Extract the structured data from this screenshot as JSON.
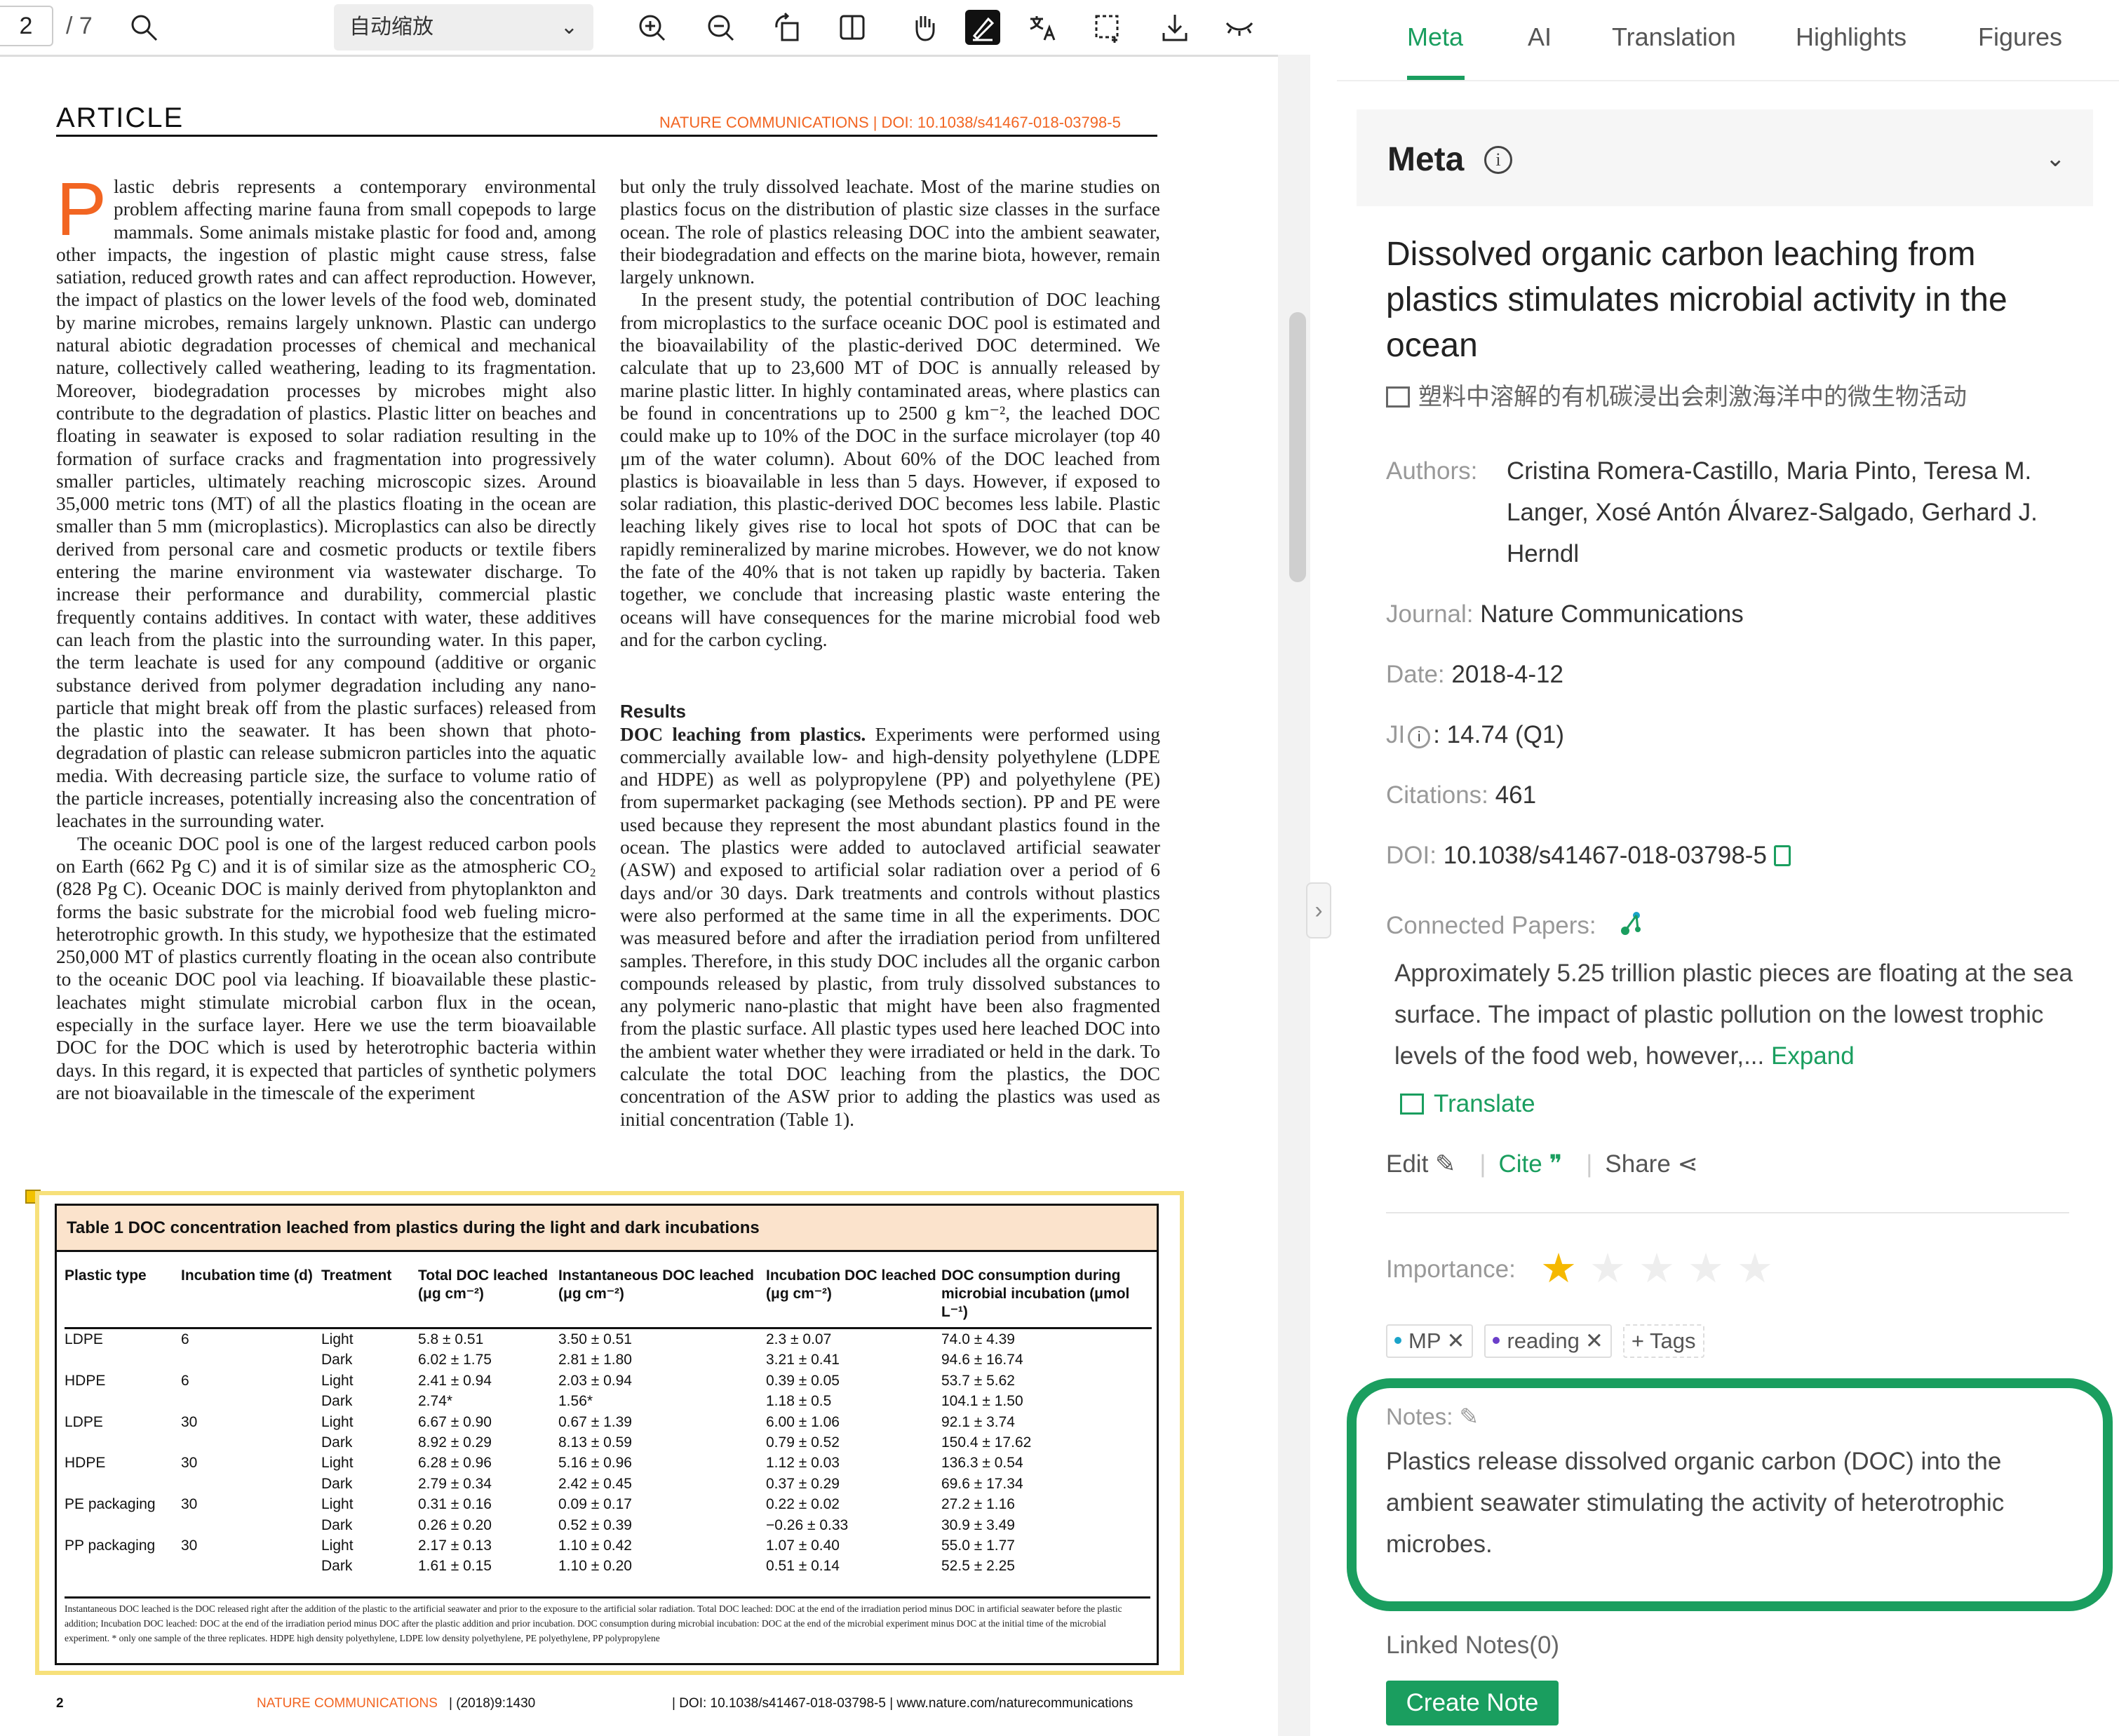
{
  "toolbar": {
    "page_current": "2",
    "page_total": "/ 7",
    "zoom_value": "自动缩放",
    "zoom_chevron": "⌄"
  },
  "document": {
    "section_label": "ARTICLE",
    "header_doi": "NATURE COMMUNICATIONS | DOI: 10.1038/s41467-018-03798-5",
    "left_col": {
      "drop_cap": "P",
      "p1": "lastic debris represents a contemporary environmental problem affecting marine fauna from small copepods to large mammals. Some animals mistake plastic for food and, among other impacts, the ingestion of plastic might cause stress, false satiation, reduced growth rates and can affect reproduction. However, the impact of plastics on the lower levels of the food web, dominated by marine microbes, remains largely unknown. Plastic can undergo natural abiotic degradation processes of chemical and mechanical nature, collectively called weathering, leading to its fragmentation. Moreover, biodegradation processes by microbes might also contribute to the degradation of plastics. Plastic litter on beaches and floating in seawater is exposed to solar radiation resulting in the formation of surface cracks and fragmentation into progressively smaller particles, ultimately reaching microscopic sizes. Around 35,000 metric tons (MT) of all the plastics floating in the ocean are smaller than 5 mm (microplastics). Microplastics can also be directly derived from personal care and cosmetic products or textile fibers entering the marine environment via wastewater discharge. To increase their performance and durability, commercial plastic frequently contains additives. In contact with water, these additives can leach from the plastic into the surrounding water. In this paper, the term leachate is used for any compound (additive or organic substance derived from polymer degradation including any nano-particle that might break off from the plastic surfaces) released from the plastic into the seawater. It has been shown that photo-degradation of plastic can release submicron particles into the aquatic media. With decreasing particle size, the surface to volume ratio of the particle increases, potentially increasing also the concentration of leachates in the surrounding water.",
      "p2": "The oceanic DOC pool is one of the largest reduced carbon pools on Earth (662 Pg C) and it is of similar size as the atmospheric CO₂ (828 Pg C). Oceanic DOC is mainly derived from phytoplankton and forms the basic substrate for the microbial food web fueling micro-heterotrophic growth. In this study, we hypothesize that the estimated 250,000 MT of plastics currently floating in the ocean also contribute to the oceanic DOC pool via leaching. If bioavailable these plastic-leachates might stimulate microbial carbon flux in the ocean, especially in the surface layer. Here we use the term bioavailable DOC for the DOC which is used by heterotrophic bacteria within days. In this regard, it is expected that particles of synthetic polymers are not bioavailable in the timescale of the experiment"
    },
    "right_col": {
      "p1": "but only the truly dissolved leachate. Most of the marine studies on plastics focus on the distribution of plastic size classes in the surface ocean. The role of plastics releasing DOC into the ambient seawater, their biodegradation and effects on the marine biota, however, remain largely unknown.",
      "p2": "In the present study, the potential contribution of DOC leaching from microplastics to the surface oceanic DOC pool is estimated and the bioavailability of the plastic-derived DOC determined. We calculate that up to 23,600 MT of DOC is annually released by marine plastic litter. In highly contaminated areas, where plastics can be found in concentrations up to 2500 g km⁻², the leached DOC could make up to 10% of the DOC in the surface microlayer (top 40 μm of the water column). About 60% of the DOC leached from plastics is bioavailable in less than 5 days. However, if exposed to solar radiation, this plastic-derived DOC becomes less labile. Plastic leaching likely gives rise to local hot spots of DOC that can be rapidly remineralized by marine microbes. However, we do not know the fate of the 40% that is not taken up rapidly by bacteria. Taken together, we conclude that increasing plastic waste entering the oceans will have consequences for the marine microbial food web and for the carbon cycling.",
      "results_head": "Results",
      "sub_head": "DOC leaching from plastics.",
      "p3": "Experiments were performed using commercially available low- and high-density polyethylene (LDPE and HDPE) as well as polypropylene (PP) and polyethylene (PE) from supermarket packaging (see Methods section). PP and PE were used because they represent the most abundant plastics found in the ocean. The plastics were added to autoclaved artificial seawater (ASW) and exposed to artificial solar radiation over a period of 6 days and/or 30 days. Dark treatments and controls without plastics were also performed at the same time in all the experiments. DOC was measured before and after the irradiation period from unfiltered samples. Therefore, in this study DOC includes all the organic carbon compounds released by plastic, from truly dissolved substances to any polymeric nano-plastic that might have been also fragmented from the plastic surface. All plastic types used here leached DOC into the ambient water whether they were irradiated or held in the dark. To calculate the total DOC leaching from the plastics, the DOC concentration of the ASW prior to adding the plastics was used as initial concentration (Table 1)."
    },
    "table": {
      "title": "Table 1 DOC concentration leached from plastics during the light and dark incubations",
      "headers": [
        "Plastic type",
        "Incubation time (d)",
        "Treatment",
        "Total DOC leached (μg cm⁻²)",
        "Instantaneous DOC leached (μg cm⁻²)",
        "Incubation DOC leached (μg cm⁻²)",
        "DOC consumption during microbial incubation (μmol L⁻¹)"
      ],
      "rows": [
        [
          "LDPE",
          "6",
          "Light",
          "5.8 ± 0.51",
          "3.50 ± 0.51",
          "2.3 ± 0.07",
          "74.0 ± 4.39"
        ],
        [
          "",
          "",
          "Dark",
          "6.02 ± 1.75",
          "2.81 ± 1.80",
          "3.21 ± 0.41",
          "94.6 ± 16.74"
        ],
        [
          "HDPE",
          "6",
          "Light",
          "2.41 ± 0.94",
          "2.03 ± 0.94",
          "0.39 ± 0.05",
          "53.7 ± 5.62"
        ],
        [
          "",
          "",
          "Dark",
          "2.74*",
          "1.56*",
          "1.18 ± 0.5",
          "104.1 ± 1.50"
        ],
        [
          "LDPE",
          "30",
          "Light",
          "6.67 ± 0.90",
          "0.67 ± 1.39",
          "6.00 ± 1.06",
          "92.1 ± 3.74"
        ],
        [
          "",
          "",
          "Dark",
          "8.92 ± 0.29",
          "8.13 ± 0.59",
          "0.79 ± 0.52",
          "150.4 ± 17.62"
        ],
        [
          "HDPE",
          "30",
          "Light",
          "6.28 ± 0.96",
          "5.16 ± 0.96",
          "1.12 ± 0.03",
          "136.3 ± 0.54"
        ],
        [
          "",
          "",
          "Dark",
          "2.79 ± 0.34",
          "2.42 ± 0.45",
          "0.37 ± 0.29",
          "69.6 ± 17.34"
        ],
        [
          "PE packaging",
          "30",
          "Light",
          "0.31 ± 0.16",
          "0.09 ± 0.17",
          "0.22 ± 0.02",
          "27.2 ± 1.16"
        ],
        [
          "",
          "",
          "Dark",
          "0.26 ± 0.20",
          "0.52 ± 0.39",
          "−0.26 ± 0.33",
          "30.9 ± 3.49"
        ],
        [
          "PP packaging",
          "30",
          "Light",
          "2.17 ± 0.13",
          "1.10 ± 0.42",
          "1.07 ± 0.40",
          "55.0 ± 1.77"
        ],
        [
          "",
          "",
          "Dark",
          "1.61 ± 0.15",
          "1.10 ± 0.20",
          "0.51 ± 0.14",
          "52.5 ± 2.25"
        ]
      ],
      "footnote": "Instantaneous DOC leached is the DOC released right after the addition of the plastic to the artificial seawater and prior to the exposure to the artificial solar radiation. Total DOC leached: DOC at the end of the irradiation period minus DOC in artificial seawater before the plastic addition; Incubation DOC leached: DOC at the end of the irradiation period minus DOC after the plastic addition and prior incubation. DOC consumption during microbial incubation: DOC at the end of the microbial experiment minus DOC at the initial time of the microbial experiment. * only one sample of the three replicates. HDPE high density polyethylene, LDPE low density polyethylene, PE polyethylene, PP polypropylene"
    },
    "footer": {
      "page_num": "2",
      "journal": "NATURE COMMUNICATIONS",
      "year": "| (2018)9:1430",
      "doi": "| DOI: 10.1038/s41467-018-03798-5 | www.nature.com/naturecommunications"
    }
  },
  "panel": {
    "tabs": [
      "Meta",
      "AI",
      "Translation",
      "Highlights",
      "Figures"
    ],
    "meta_heading": "Meta",
    "paper_title": "Dissolved organic carbon leaching from plastics stimulates microbial activity in the ocean",
    "paper_title_cn": "塑料中溶解的有机碳浸出会刺激海洋中的微生物活动",
    "authors_label": "Authors:",
    "authors_value": "Cristina Romera-Castillo, Maria Pinto, Teresa M. Langer, Xosé Antón Álvarez-Salgado, Gerhard J. Herndl",
    "journal_label": "Journal:",
    "journal_value": "Nature Communications",
    "date_label": "Date:",
    "date_value": "2018-4-12",
    "ji_label": "JI",
    "ji_value": ": 14.74  (Q1)",
    "citations_label": "Citations:",
    "citations_value": "461",
    "doi_label": "DOI:",
    "doi_value": "10.1038/s41467-018-03798-5",
    "connected_label": "Connected Papers:",
    "abstract": "Approximately 5.25 trillion plastic pieces are floating at the sea surface. The impact of plastic pollution on the lowest trophic levels of the food web, however,...",
    "expand_label": "Expand",
    "translate_label": "Translate",
    "edit_label": "Edit",
    "cite_label": "Cite",
    "share_label": "Share",
    "importance_label": "Importance:",
    "importance_rating": 1,
    "importance_max": 5,
    "tags": [
      {
        "label": "MP",
        "color": "#1aa3c9"
      },
      {
        "label": "reading",
        "color": "#6b3fc9"
      }
    ],
    "add_tag_label": "Tags",
    "notes_label": "Notes:",
    "notes_text": "Plastics release dissolved organic carbon (DOC) into the ambient seawater stimulating the activity of heterotrophic microbes.",
    "linked_notes_label": "Linked Notes(0)",
    "create_note_label": "Create Note"
  },
  "colors": {
    "accent": "#1a9e5f",
    "journal_orange": "#f26522",
    "star_active": "#f5b800",
    "highlight_frame": "#f7e07a",
    "table_title_bg": "#fbe3cc"
  }
}
